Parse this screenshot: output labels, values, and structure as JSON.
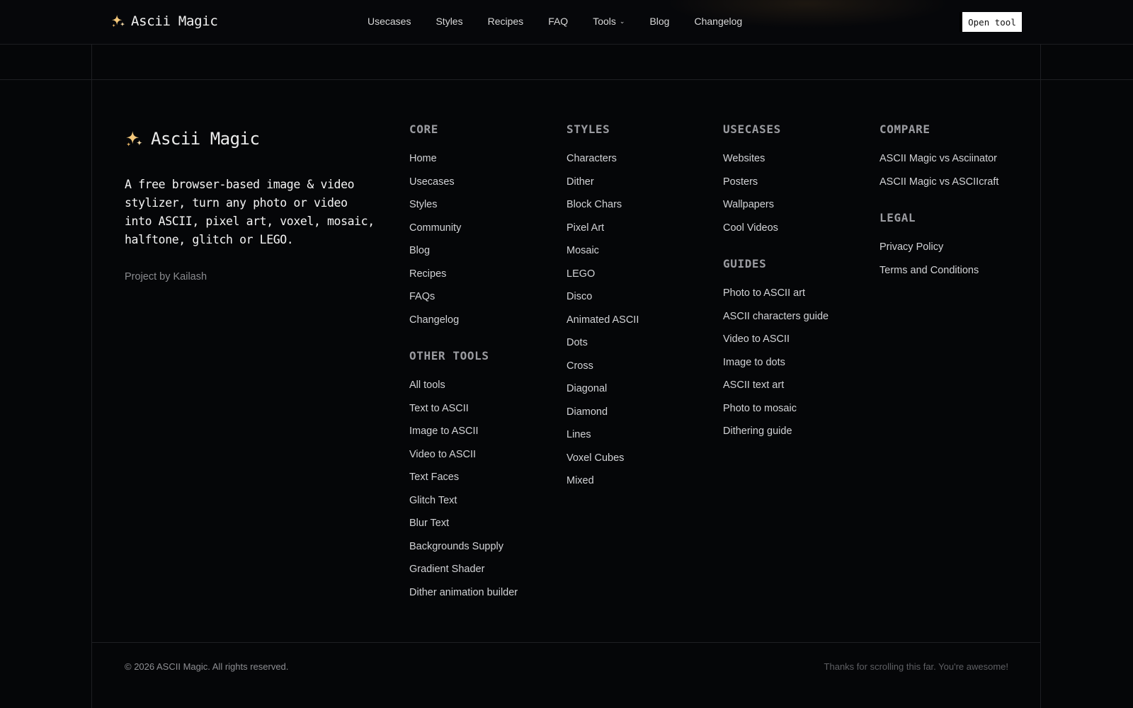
{
  "nav": {
    "brand": "Ascii Magic",
    "links": [
      "Usecases",
      "Styles",
      "Recipes",
      "FAQ",
      "Tools",
      "Blog",
      "Changelog"
    ],
    "tools_chevron": "chevron-down-icon",
    "cta": "Open tool"
  },
  "footer": {
    "brand": "Ascii Magic",
    "tagline": "A free browser-based image & video stylizer, turn any photo or video into ASCII, pixel art, voxel, mosaic, halftone, glitch or LEGO.",
    "byline": "Project by Kailash",
    "columns": {
      "core": {
        "heading": "CORE",
        "links": [
          "Home",
          "Usecases",
          "Styles",
          "Community",
          "Blog",
          "Recipes",
          "FAQs",
          "Changelog"
        ]
      },
      "other_tools": {
        "heading": "OTHER TOOLS",
        "links": [
          "All tools",
          "Text to ASCII",
          "Image to ASCII",
          "Video to ASCII",
          "Text Faces",
          "Glitch Text",
          "Blur Text",
          "Backgrounds Supply",
          "Gradient Shader",
          "Dither animation builder"
        ]
      },
      "styles": {
        "heading": "STYLES",
        "links": [
          "Characters",
          "Dither",
          "Block Chars",
          "Pixel Art",
          "Mosaic",
          "LEGO",
          "Disco",
          "Animated ASCII",
          "Dots",
          "Cross",
          "Diagonal",
          "Diamond",
          "Lines",
          "Voxel Cubes",
          "Mixed"
        ]
      },
      "usecases": {
        "heading": "USECASES",
        "links": [
          "Websites",
          "Posters",
          "Wallpapers",
          "Cool Videos"
        ]
      },
      "guides": {
        "heading": "GUIDES",
        "links": [
          "Photo to ASCII art",
          "ASCII characters guide",
          "Video to ASCII",
          "Image to dots",
          "ASCII text art",
          "Photo to mosaic",
          "Dithering guide"
        ]
      },
      "compare": {
        "heading": "COMPARE",
        "links": [
          "ASCII Magic vs Asciinator",
          "ASCII Magic vs ASCIIcraft"
        ]
      },
      "legal": {
        "heading": "LEGAL",
        "links": [
          "Privacy Policy",
          "Terms and Conditions"
        ]
      }
    },
    "copyright": "© 2026 ASCII Magic. All rights reserved.",
    "thanks": "Thanks for scrolling this far. You're awesome!"
  },
  "icons": {
    "brand_logo": "sparkle-icon"
  },
  "colors": {
    "background": "#050608",
    "spark_gold": "#f3c77a",
    "heading_gray": "#9b9ca1",
    "link_text": "#d2d3d6",
    "cta_bg": "#ffffff"
  }
}
